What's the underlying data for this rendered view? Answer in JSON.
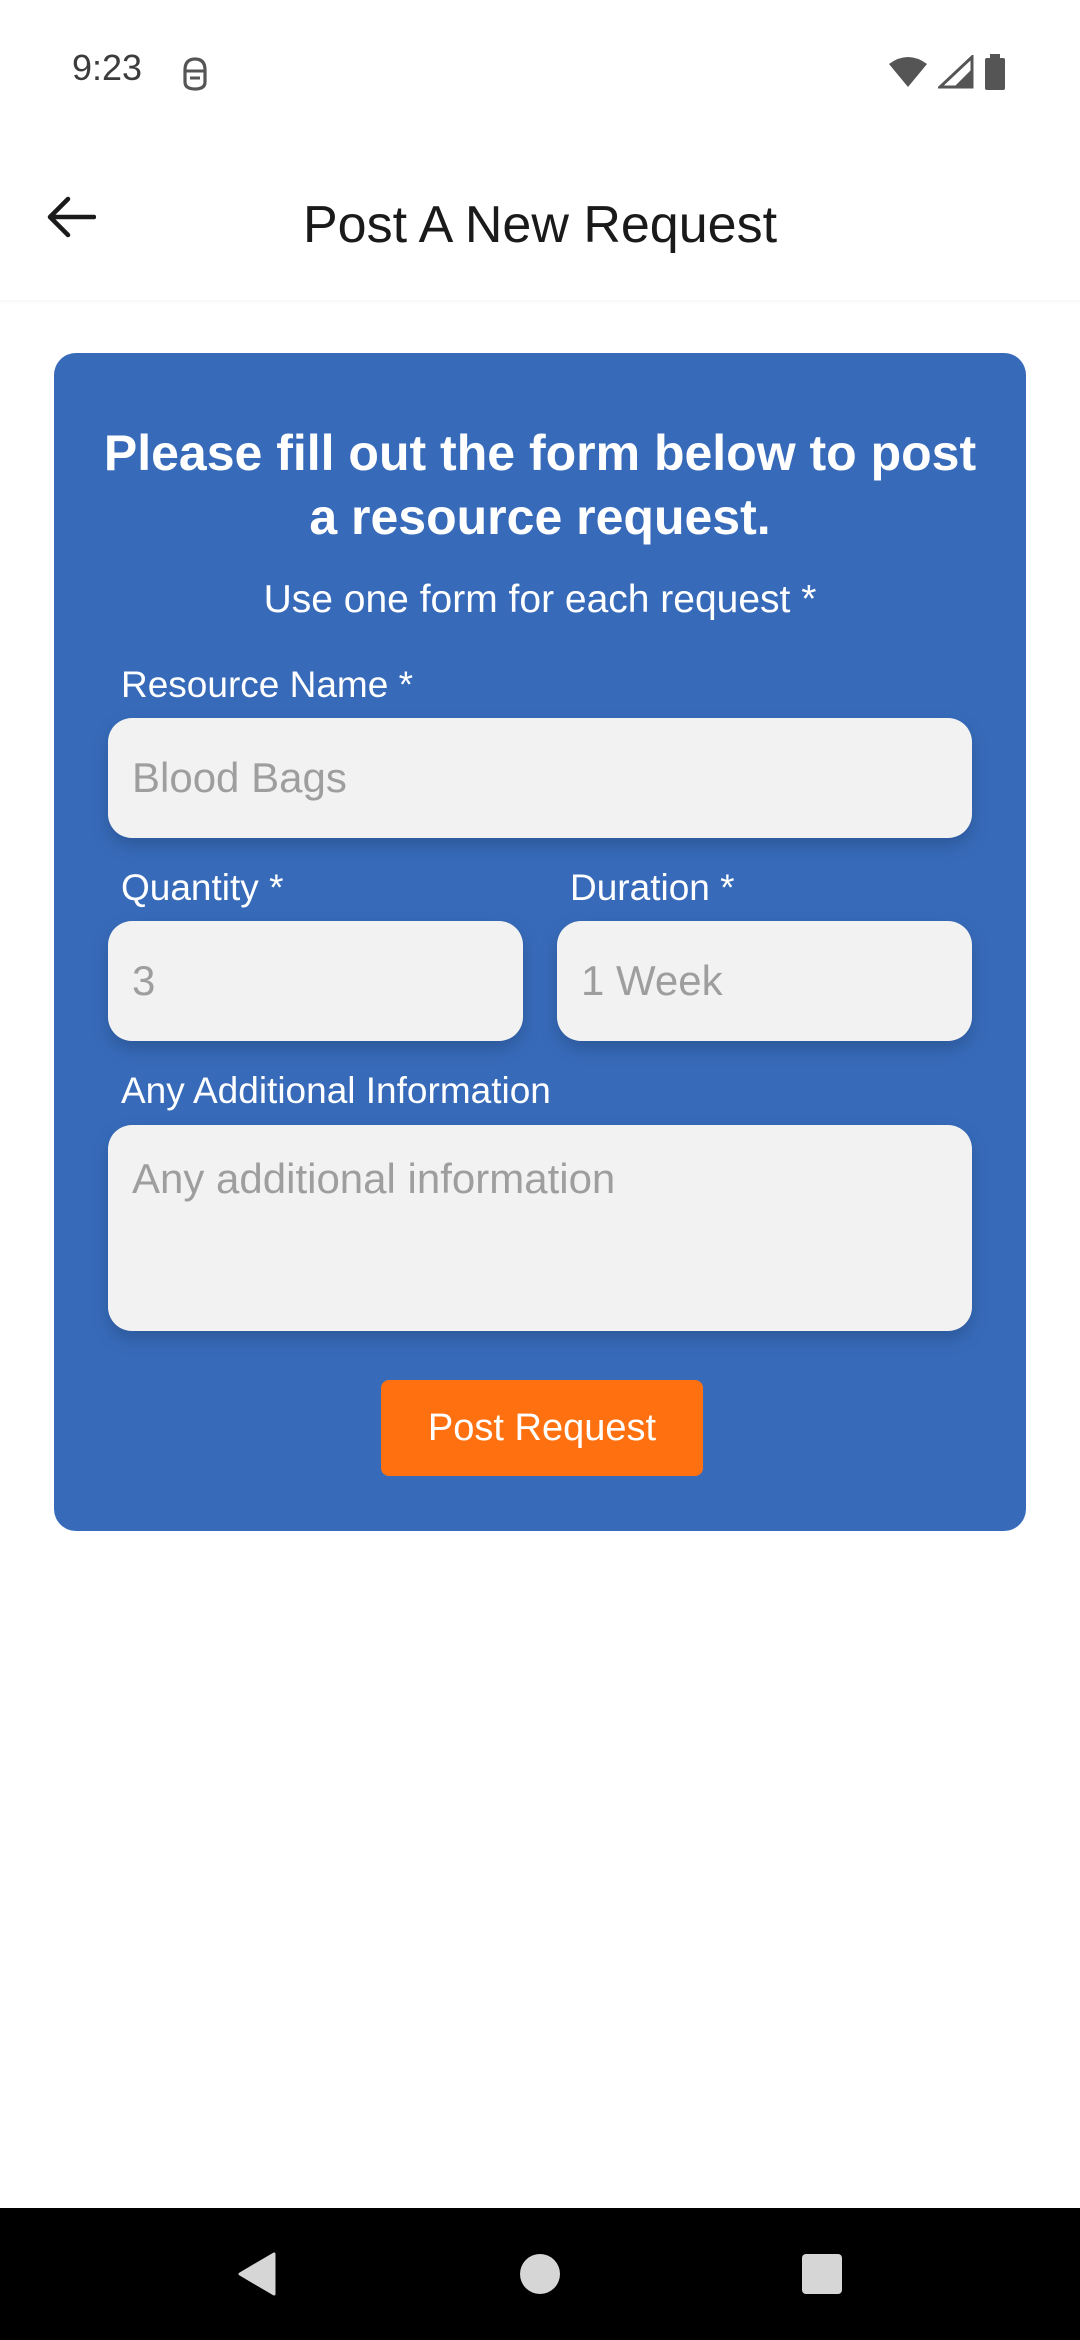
{
  "status_bar": {
    "time": "9:23",
    "icons": [
      "app-notification-icon",
      "wifi-icon",
      "signal-icon",
      "battery-icon"
    ]
  },
  "app_bar": {
    "title": "Post A New Request",
    "back_icon": "arrow-back-icon"
  },
  "form": {
    "heading": "Please fill out the form below to post a resource request.",
    "subheading": "Use one form for each request *",
    "resource_name": {
      "label": "Resource Name *",
      "placeholder": "Blood Bags"
    },
    "quantity": {
      "label": "Quantity *",
      "placeholder": "3"
    },
    "duration": {
      "label": "Duration *",
      "placeholder": "1 Week"
    },
    "additional_info": {
      "label": "Any Additional Information",
      "placeholder": "Any additional information"
    },
    "submit_label": "Post Request"
  },
  "nav_bar": {
    "icons": [
      "nav-back-icon",
      "nav-home-icon",
      "nav-recents-icon"
    ]
  },
  "colors": {
    "card": "#376bba",
    "button": "#ff7010",
    "field": "#f2f2f2"
  }
}
